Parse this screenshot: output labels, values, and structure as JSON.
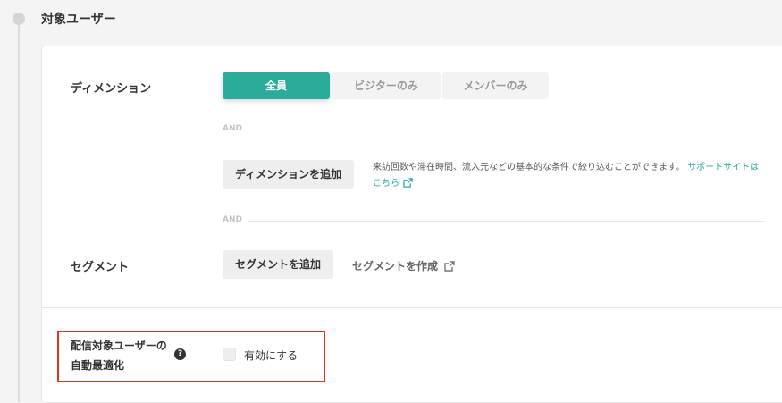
{
  "section": {
    "title": "対象ユーザー"
  },
  "dimension": {
    "label": "ディメンション",
    "options": [
      "全員",
      "ビジターのみ",
      "メンバーのみ"
    ],
    "selected": "全員",
    "and_label": "AND",
    "add_button": "ディメンションを追加",
    "help_text": "来訪回数や滞在時間、流入元などの基本的な条件で絞り込むことができます。",
    "help_link": "サポートサイトはこちら"
  },
  "segment": {
    "label": "セグメント",
    "and_label": "AND",
    "add_button": "セグメントを追加",
    "create_link": "セグメントを作成"
  },
  "optimization": {
    "label_line1": "配信対象ユーザーの",
    "label_line2": "自動最適化",
    "help_icon": "question-circle-icon",
    "checkbox_label": "有効にする",
    "checked": false
  },
  "colors": {
    "accent": "#2bac9b",
    "highlight": "#e0321c"
  }
}
